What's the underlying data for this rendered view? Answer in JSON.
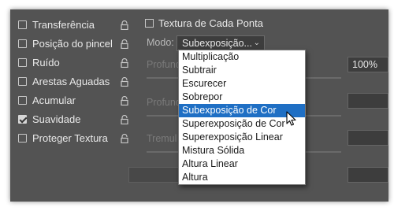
{
  "options": [
    {
      "label": "Transferência",
      "checked": false
    },
    {
      "label": "Posição do pincel",
      "checked": false
    },
    {
      "label": "Ruído",
      "checked": false
    },
    {
      "label": "Arestas Aguadas",
      "checked": false
    },
    {
      "label": "Acumular",
      "checked": false
    },
    {
      "label": "Suavidade",
      "checked": true
    },
    {
      "label": "Proteger Textura",
      "checked": false
    }
  ],
  "texture": {
    "each_tip_label": "Textura de Cada Ponta"
  },
  "mode": {
    "label": "Modo:",
    "selected": "Subexposição..."
  },
  "depth": {
    "label": "Profund",
    "value": "100%"
  },
  "min_depth": {
    "label": "Profund"
  },
  "jitter": {
    "label": "Tremul"
  },
  "dropdown": {
    "items": [
      "Multiplicação",
      "Subtrair",
      "Escurecer",
      "Sobrepor",
      "Subexposição de Cor",
      "Superexposição de Cor",
      "Superexposição Linear",
      "Mistura Sólida",
      "Altura Linear",
      "Altura"
    ],
    "highlighted_index": 4
  }
}
